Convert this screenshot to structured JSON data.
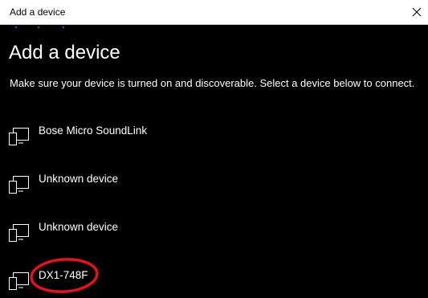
{
  "window": {
    "title": "Add a device",
    "close_icon": "close-icon"
  },
  "page": {
    "heading": "Add a device",
    "instructions": "Make sure your device is turned on and discoverable. Select a device below to connect."
  },
  "devices": [
    {
      "name": "Bose Micro SoundLink",
      "icon": "device-icon"
    },
    {
      "name": "Unknown device",
      "icon": "device-icon"
    },
    {
      "name": "Unknown device",
      "icon": "device-icon"
    },
    {
      "name": "DX1-748F",
      "icon": "device-icon"
    }
  ],
  "colors": {
    "background": "#000000",
    "titlebar": "#ffffff",
    "text": "#ffffff",
    "annotation": "#e0141e",
    "progress": "#3a7bd5"
  }
}
